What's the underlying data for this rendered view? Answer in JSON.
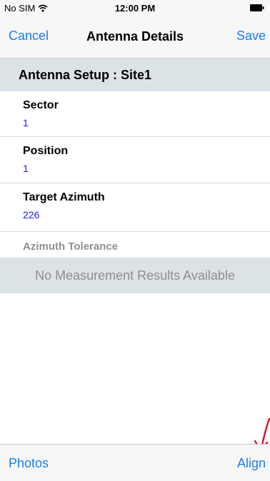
{
  "status_bar": {
    "carrier": "No SIM",
    "time": "12:00 PM",
    "wifi_icon": "wifi-icon",
    "battery_icon": "battery-icon"
  },
  "nav": {
    "cancel_label": "Cancel",
    "title": "Antenna Details",
    "save_label": "Save"
  },
  "section": {
    "header": "Antenna Setup : Site1"
  },
  "fields": [
    {
      "label": "Sector",
      "value": "1"
    },
    {
      "label": "Position",
      "value": "1"
    },
    {
      "label": "Target Azimuth",
      "value": "226"
    },
    {
      "label": "Azimuth Tolerance"
    }
  ],
  "results": {
    "empty_message": "No Measurement Results Available"
  },
  "toolbar": {
    "photos_label": "Photos",
    "align_label": "Align"
  },
  "colors": {
    "tint": "#1a7cf4",
    "value_text": "#1a1aff",
    "section_bg": "#dbe3e7",
    "annotation_arrow": "#e0101a"
  },
  "annotation": {
    "icon": "red-arrow-icon"
  }
}
